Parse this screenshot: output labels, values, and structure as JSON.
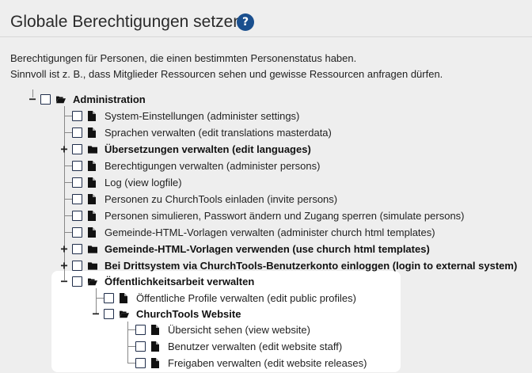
{
  "title": "Globale Berechtigungen setzen",
  "help_icon_label": "?",
  "description": [
    "Berechtigungen für Personen, die einen bestimmten Personenstatus haben.",
    "Sinnvoll ist z. B., dass Mitglieder Ressourcen sehen und gewisse Ressourcen anfragen dürfen."
  ],
  "tree": {
    "root": {
      "label": "Administration",
      "expander": "−",
      "icon": "folder-open-icon"
    },
    "items": [
      {
        "label": "System-Einstellungen (administer settings)",
        "icon": "file-icon",
        "bold": false,
        "expander": ""
      },
      {
        "label": "Sprachen verwalten (edit translations masterdata)",
        "icon": "file-icon",
        "bold": false,
        "expander": ""
      },
      {
        "label": "Übersetzungen verwalten (edit languages)",
        "icon": "folder-icon",
        "bold": true,
        "expander": "+"
      },
      {
        "label": "Berechtigungen verwalten (administer persons)",
        "icon": "file-icon",
        "bold": false,
        "expander": ""
      },
      {
        "label": "Log (view logfile)",
        "icon": "file-icon",
        "bold": false,
        "expander": ""
      },
      {
        "label": "Personen zu ChurchTools einladen (invite persons)",
        "icon": "file-icon",
        "bold": false,
        "expander": ""
      },
      {
        "label": "Personen simulieren, Passwort ändern und Zugang sperren (simulate persons)",
        "icon": "file-icon",
        "bold": false,
        "expander": ""
      },
      {
        "label": "Gemeinde-HTML-Vorlagen verwalten (administer church html templates)",
        "icon": "file-icon",
        "bold": false,
        "expander": ""
      },
      {
        "label": "Gemeinde-HTML-Vorlagen verwenden (use church html templates)",
        "icon": "folder-icon",
        "bold": true,
        "expander": "+"
      },
      {
        "label": "Bei Drittsystem via ChurchTools-Benutzerkonto einloggen (login to external system)",
        "icon": "folder-icon",
        "bold": true,
        "expander": "+"
      },
      {
        "label": "Öffentlichkeitsarbeit verwalten",
        "icon": "folder-open-icon",
        "bold": true,
        "expander": "−"
      }
    ],
    "public_relations_children": [
      {
        "label": "Öffentliche Profile verwalten (edit public profiles)",
        "icon": "file-icon",
        "bold": false,
        "expander": ""
      },
      {
        "label": "ChurchTools Website",
        "icon": "folder-open-icon",
        "bold": true,
        "expander": "−"
      }
    ],
    "website_children": [
      {
        "label": "Übersicht sehen (view website)",
        "icon": "file-icon",
        "bold": false,
        "expander": ""
      },
      {
        "label": "Benutzer verwalten (edit website staff)",
        "icon": "file-icon",
        "bold": false,
        "expander": ""
      },
      {
        "label": "Freigaben verwalten (edit website releases)",
        "icon": "file-icon",
        "bold": false,
        "expander": ""
      }
    ]
  }
}
